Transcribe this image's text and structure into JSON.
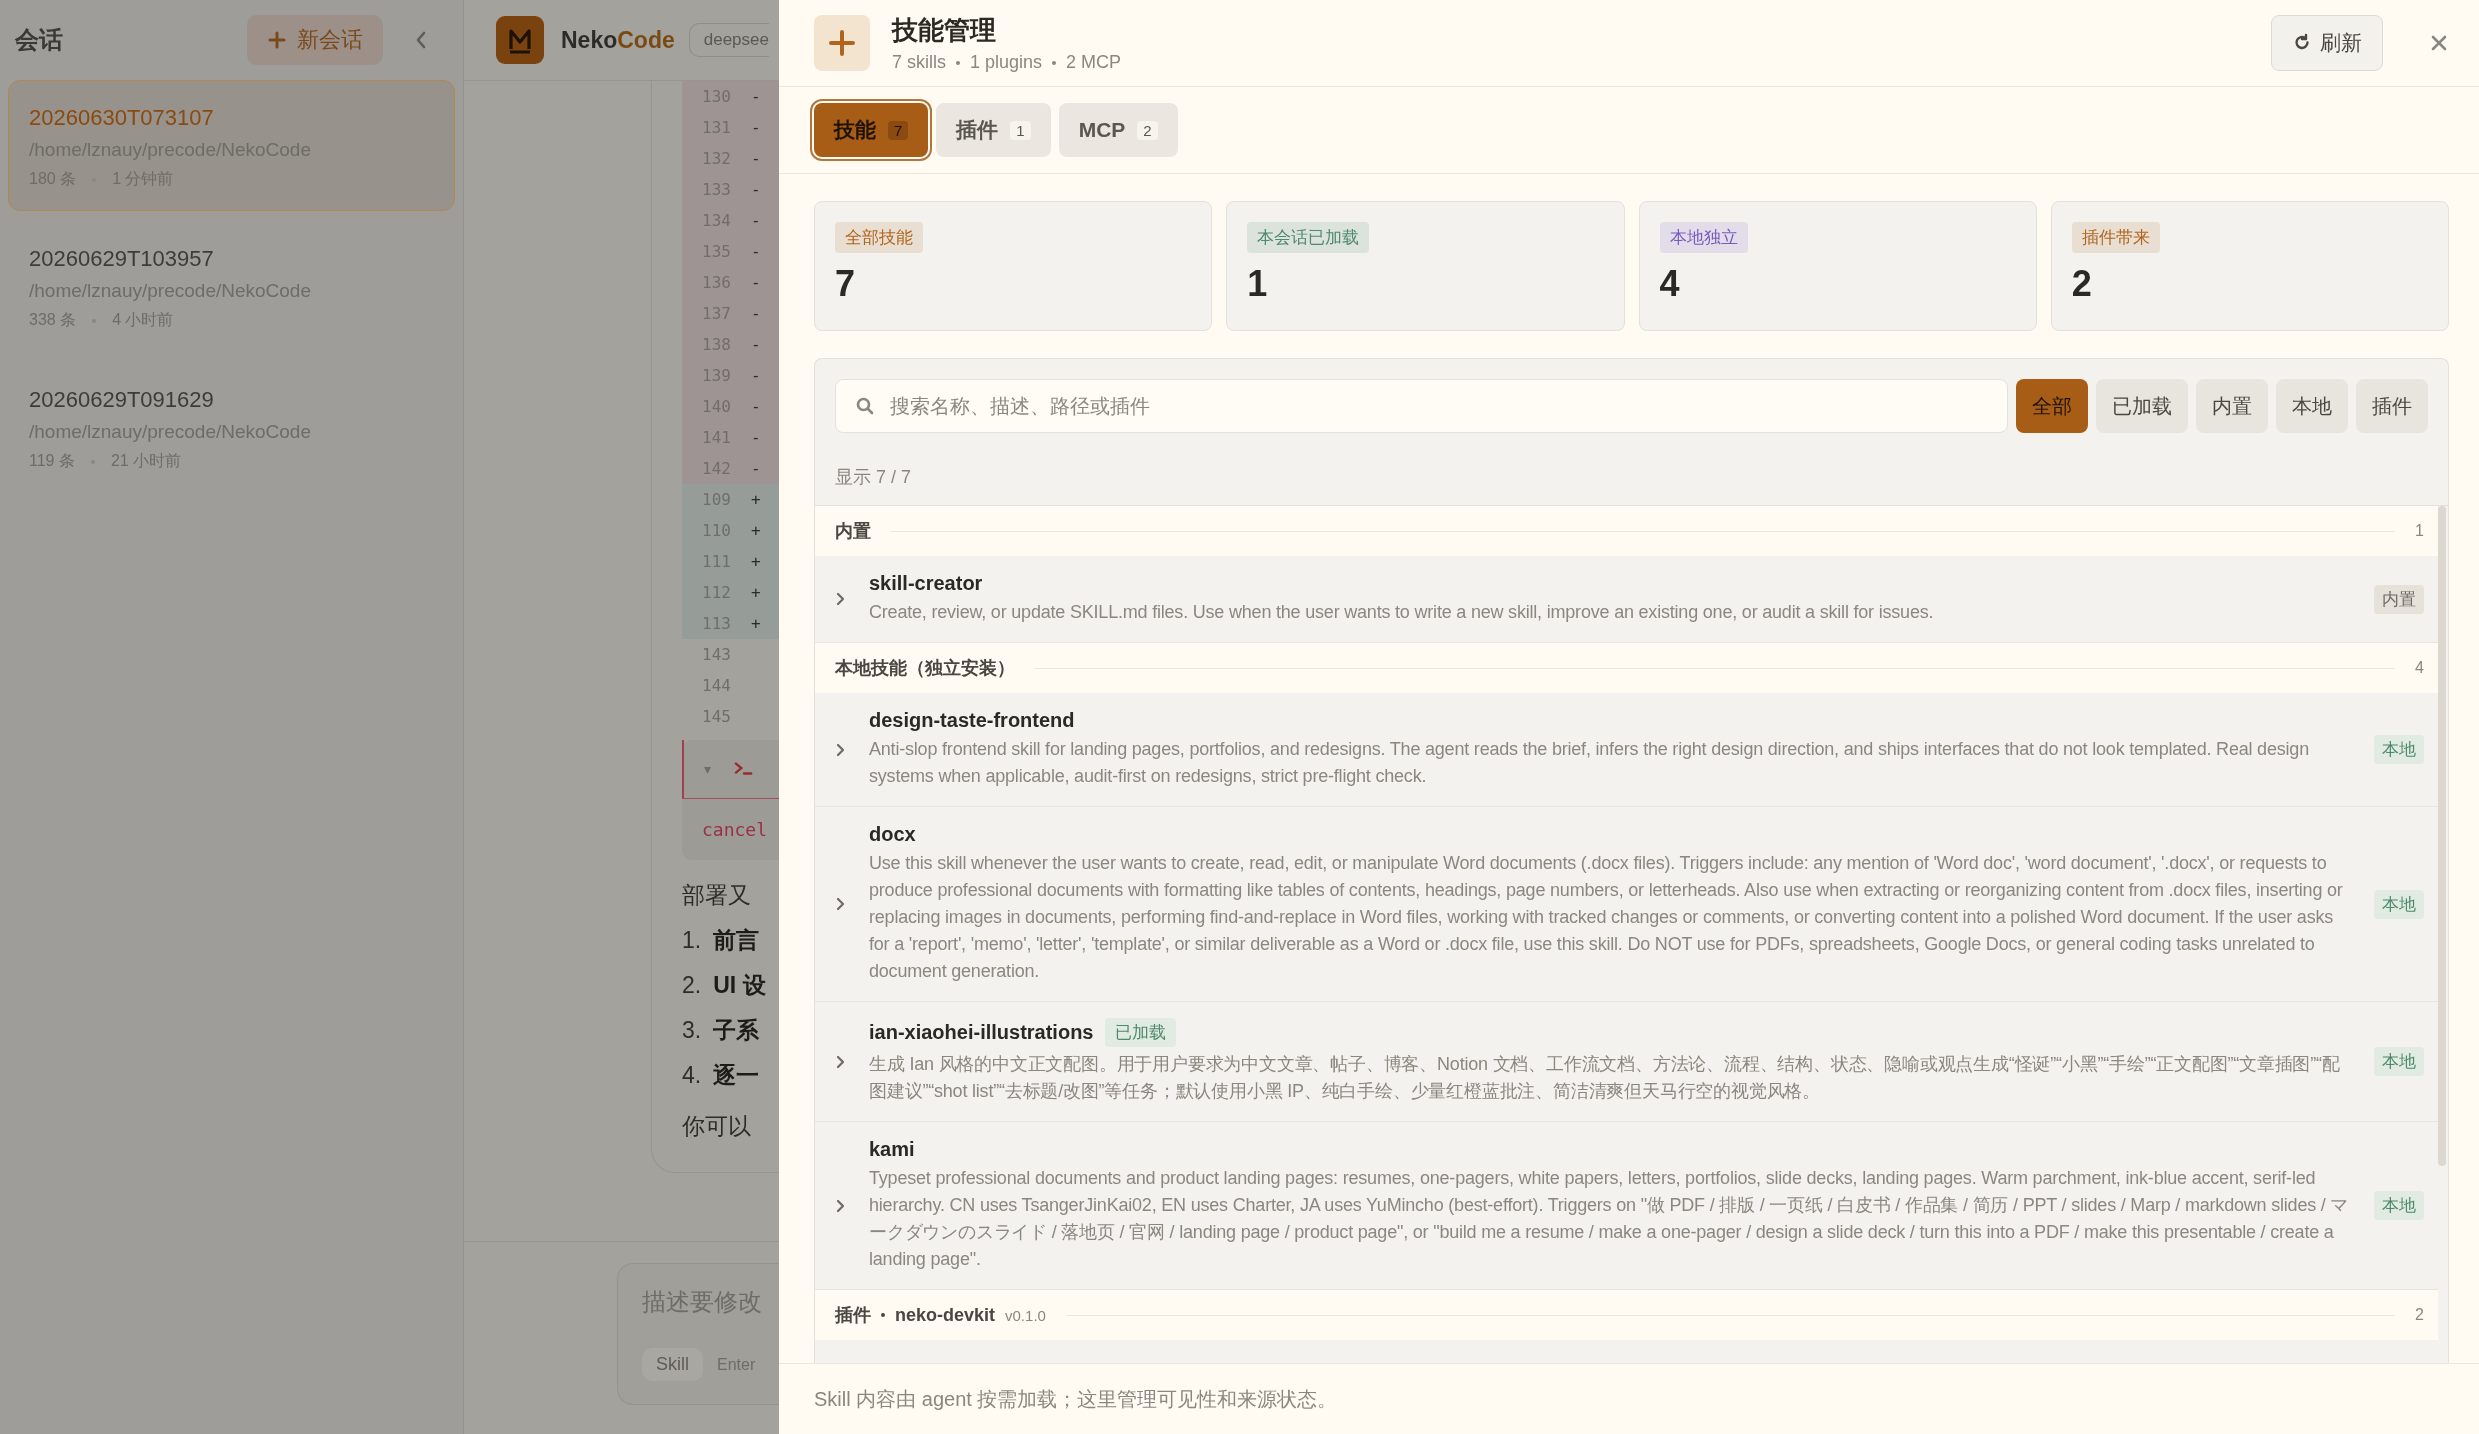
{
  "sidebar": {
    "title": "会话",
    "new_button": "新会话",
    "sessions": [
      {
        "title": "20260630T073107",
        "path": "/home/lznauy/precode/NekoCode",
        "count": "180 条",
        "time": "1 分钟前",
        "selected": true
      },
      {
        "title": "20260629T103957",
        "path": "/home/lznauy/precode/NekoCode",
        "count": "338 条",
        "time": "4 小时前",
        "selected": false
      },
      {
        "title": "20260629T091629",
        "path": "/home/lznauy/precode/NekoCode",
        "count": "119 条",
        "time": "21 小时前",
        "selected": false
      }
    ]
  },
  "main": {
    "brand_prefix": "Neko",
    "brand_suffix": "Code",
    "model_chip": "deepsee",
    "diff_lines": [
      {
        "number": "130",
        "sign": "-",
        "kind": "removed"
      },
      {
        "number": "131",
        "sign": "-",
        "kind": "removed"
      },
      {
        "number": "132",
        "sign": "-",
        "kind": "removed"
      },
      {
        "number": "133",
        "sign": "-",
        "kind": "removed"
      },
      {
        "number": "134",
        "sign": "-",
        "kind": "removed"
      },
      {
        "number": "135",
        "sign": "-",
        "kind": "removed"
      },
      {
        "number": "136",
        "sign": "-",
        "kind": "removed"
      },
      {
        "number": "137",
        "sign": "-",
        "kind": "removed"
      },
      {
        "number": "138",
        "sign": "-",
        "kind": "removed"
      },
      {
        "number": "139",
        "sign": "-",
        "kind": "removed"
      },
      {
        "number": "140",
        "sign": "-",
        "kind": "removed"
      },
      {
        "number": "141",
        "sign": "-",
        "kind": "removed"
      },
      {
        "number": "142",
        "sign": "-",
        "kind": "removed"
      },
      {
        "number": "109",
        "sign": "+",
        "kind": "added"
      },
      {
        "number": "110",
        "sign": "+",
        "kind": "added"
      },
      {
        "number": "111",
        "sign": "+",
        "kind": "added"
      },
      {
        "number": "112",
        "sign": "+",
        "kind": "added"
      },
      {
        "number": "113",
        "sign": "+",
        "kind": "added"
      },
      {
        "number": "143",
        "kind": "context"
      },
      {
        "number": "144",
        "kind": "context"
      },
      {
        "number": "145",
        "kind": "context"
      }
    ],
    "tool_caret": "▾",
    "tool_output": "cancel",
    "message_text": "部署又",
    "message_list": [
      {
        "marker": "1.",
        "text": "前言"
      },
      {
        "marker": "2.",
        "text": "UI 设"
      },
      {
        "marker": "3.",
        "text": "子系"
      },
      {
        "marker": "4.",
        "text": "逐一"
      }
    ],
    "message_tail": "你可以",
    "composer": {
      "placeholder": "描述要修改",
      "skill_chip": "Skill",
      "hint": "Enter"
    }
  },
  "panel": {
    "title": "技能管理",
    "subtitle": [
      "7 skills",
      "1 plugins",
      "2 MCP"
    ],
    "refresh_button": "刷新",
    "tabs": [
      {
        "label": "技能",
        "count": "7",
        "selected": true
      },
      {
        "label": "插件",
        "count": "1",
        "selected": false
      },
      {
        "label": "MCP",
        "count": "2",
        "selected": false
      }
    ],
    "stats": [
      {
        "label": "全部技能",
        "value": "7",
        "color": "#b0651e"
      },
      {
        "label": "本会话已加载",
        "value": "1",
        "color": "#4e8a6c"
      },
      {
        "label": "本地独立",
        "value": "4",
        "color": "#7a5cc0"
      },
      {
        "label": "插件带来",
        "value": "2",
        "color": "#b0651e"
      }
    ],
    "search": {
      "placeholder": "搜索名称、描述、路径或插件"
    },
    "filters": [
      {
        "label": "全部",
        "selected": true
      },
      {
        "label": "已加载",
        "selected": false
      },
      {
        "label": "内置",
        "selected": false
      },
      {
        "label": "本地",
        "selected": false
      },
      {
        "label": "插件",
        "selected": false
      }
    ],
    "count_text": "显示 7 / 7",
    "groups": [
      {
        "kind": "section",
        "title": "内置",
        "count": "1",
        "skills": [
          {
            "name": "skill-creator",
            "description": "Create, review, or update SKILL.md files. Use when the user wants to write a new skill, improve an existing one, or audit a skill for issues.",
            "badge": "内置",
            "kind": "builtin"
          }
        ]
      },
      {
        "kind": "section",
        "title": "本地技能（独立安装）",
        "count": "4",
        "skills": [
          {
            "name": "design-taste-frontend",
            "description": "Anti-slop frontend skill for landing pages, portfolios, and redesigns. The agent reads the brief, infers the right design direction, and ships interfaces that do not look templated. Real design systems when applicable, audit-first on redesigns, strict pre-flight check.",
            "badge": "本地",
            "kind": "local"
          },
          {
            "name": "docx",
            "description": "Use this skill whenever the user wants to create, read, edit, or manipulate Word documents (.docx files). Triggers include: any mention of 'Word doc', 'word document', '.docx', or requests to produce professional documents with formatting like tables of contents, headings, page numbers, or letterheads. Also use when extracting or reorganizing content from .docx files, inserting or replacing images in documents, performing find-and-replace in Word files, working with tracked changes or comments, or converting content into a polished Word document. If the user asks for a 'report', 'memo', 'letter', 'template', or similar deliverable as a Word or .docx file, use this skill. Do NOT use for PDFs, spreadsheets, Google Docs, or general coding tasks unrelated to document generation.",
            "badge": "本地",
            "kind": "local"
          },
          {
            "name": "ian-xiaohei-illustrations",
            "tag": "已加载",
            "description": "生成 Ian 风格的中文正文配图。用于用户要求为中文文章、帖子、博客、Notion 文档、工作流文档、方法论、流程、结构、状态、隐喻或观点生成“怪诞”“小黑”“手绘”“正文配图”“文章插图”“配图建议”“shot list”“去标题/改图”等任务；默认使用小黑 IP、纯白手绘、少量红橙蓝批注、简洁清爽但天马行空的视觉风格。",
            "badge": "本地",
            "kind": "local"
          },
          {
            "name": "kami",
            "description": "Typeset professional documents and product landing pages: resumes, one-pagers, white papers, letters, portfolios, slide decks, landing pages. Warm parchment, ink-blue accent, serif-led hierarchy. CN uses TsangerJinKai02, EN uses Charter, JA uses YuMincho (best-effort). Triggers on \"做 PDF / 排版 / 一页纸 / 白皮书 / 作品集 / 简历 / PPT / slides / Marp / markdown slides / マークダウンのスライド / 落地页 / 官网 / landing page / product page\", or \"build me a resume / make a one-pager / design a slide deck / turn this into a PDF / make this presentable / create a landing page\".",
            "badge": "本地",
            "kind": "local"
          }
        ]
      },
      {
        "kind": "plugin",
        "title": "插件",
        "plugin": "neko-devkit",
        "version": "v0.1.0",
        "count": "2"
      }
    ],
    "footer_note": "Skill 内容由 agent 按需加载；这里管理可见性和来源状态。"
  }
}
